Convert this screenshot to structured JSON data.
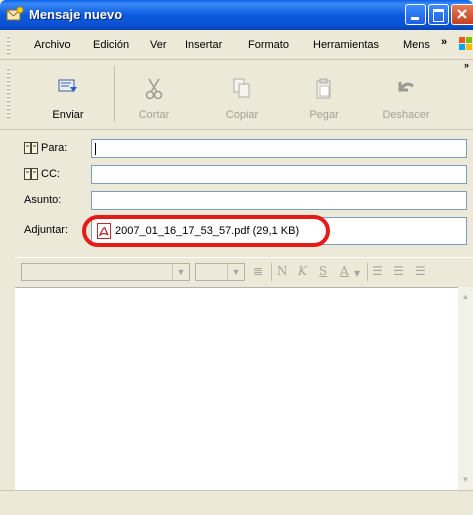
{
  "window": {
    "title": "Mensaje nuevo"
  },
  "menu": {
    "items": [
      "Archivo",
      "Edición",
      "Ver",
      "Insertar",
      "Formato",
      "Herramientas",
      "Mens"
    ],
    "overflow": "»"
  },
  "toolbar": {
    "buttons": [
      {
        "label": "Enviar",
        "icon": "send-icon",
        "enabled": true
      },
      {
        "label": "Cortar",
        "icon": "scissors-icon",
        "enabled": false
      },
      {
        "label": "Copiar",
        "icon": "copy-icon",
        "enabled": false
      },
      {
        "label": "Pegar",
        "icon": "paste-icon",
        "enabled": false
      },
      {
        "label": "Deshacer",
        "icon": "undo-icon",
        "enabled": false
      }
    ],
    "overflow": "»"
  },
  "header": {
    "to_label": "Para:",
    "to_value": "",
    "cc_label": "CC:",
    "cc_value": "",
    "subject_label": "Asunto:",
    "subject_value": "",
    "attach_label": "Adjuntar:",
    "attachment": "2007_01_16_17_53_57.pdf (29,1 KB)"
  },
  "formatting": {
    "bold": "N",
    "italic": "K",
    "underline": "S",
    "font_color": "A"
  },
  "colors": {
    "titlebar": "#0a52d1",
    "highlight_ring": "#e41b17"
  }
}
